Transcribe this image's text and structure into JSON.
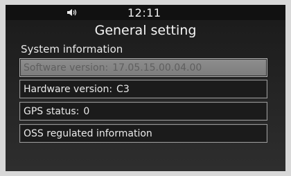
{
  "status": {
    "volume_icon": "speaker-volume-icon",
    "time": "12:11"
  },
  "page": {
    "title": "General setting",
    "section": "System information"
  },
  "items": [
    {
      "label": "Software version:",
      "value": "17.05.15.00.04.00",
      "enabled": false
    },
    {
      "label": "Hardware version:",
      "value": "C3",
      "enabled": true
    },
    {
      "label": "GPS status:",
      "value": "0",
      "enabled": true
    },
    {
      "label": "OSS regulated information",
      "value": "",
      "enabled": true
    }
  ],
  "colors": {
    "screen_bg": "#1a1a1a",
    "item_border": "#9a9a9a",
    "disabled_fill": "#8e8e8e",
    "text": "#f2f2f2"
  }
}
